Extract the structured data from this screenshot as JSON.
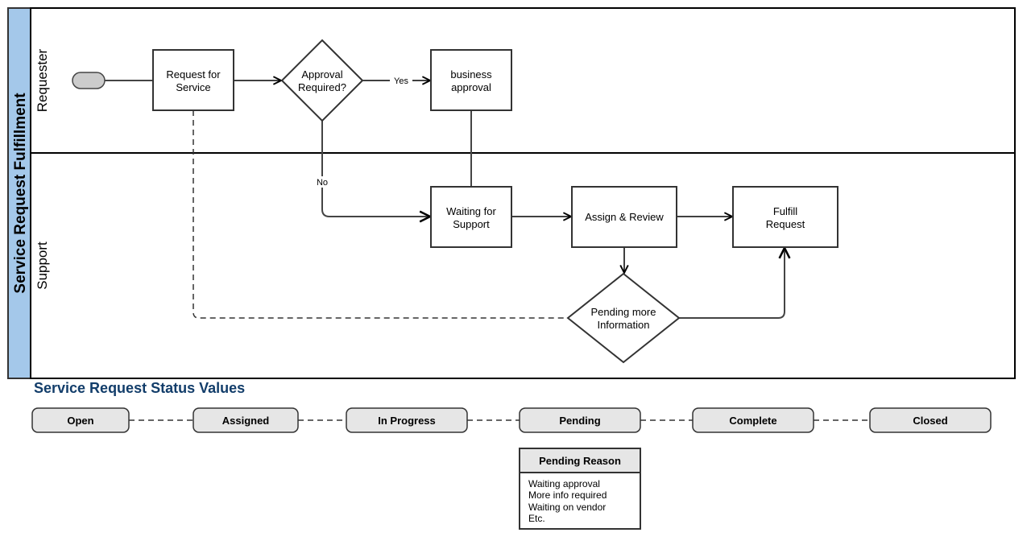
{
  "pool": {
    "title": "Service Request Fulfillment",
    "header_color": "#a4c8ea",
    "lanes": [
      {
        "label": "Requester"
      },
      {
        "label": "Support"
      }
    ]
  },
  "nodes": {
    "start": {
      "type": "start-event"
    },
    "request_for_service": {
      "line1": "Request for",
      "line2": "Service"
    },
    "approval_required": {
      "line1": "Approval",
      "line2": "Required?"
    },
    "business_approval": {
      "line1": "business",
      "line2": "approval"
    },
    "waiting_for_support": {
      "line1": "Waiting for",
      "line2": "Support"
    },
    "assign_review": {
      "line1": "Assign & Review"
    },
    "fulfill_request": {
      "line1": "Fulfill",
      "line2": "Request"
    },
    "pending_more_info": {
      "line1": "Pending more",
      "line2": "Information"
    }
  },
  "edges": {
    "yes_label": "Yes",
    "no_label": "No"
  },
  "status_section": {
    "title": "Service Request Status Values",
    "title_color": "#123d6a",
    "statuses": [
      "Open",
      "Assigned",
      "In Progress",
      "Pending",
      "Complete",
      "Closed"
    ],
    "pending_reason": {
      "title": "Pending Reason",
      "items": [
        "Waiting approval",
        "More info required",
        "Waiting on vendor",
        "Etc."
      ]
    }
  }
}
